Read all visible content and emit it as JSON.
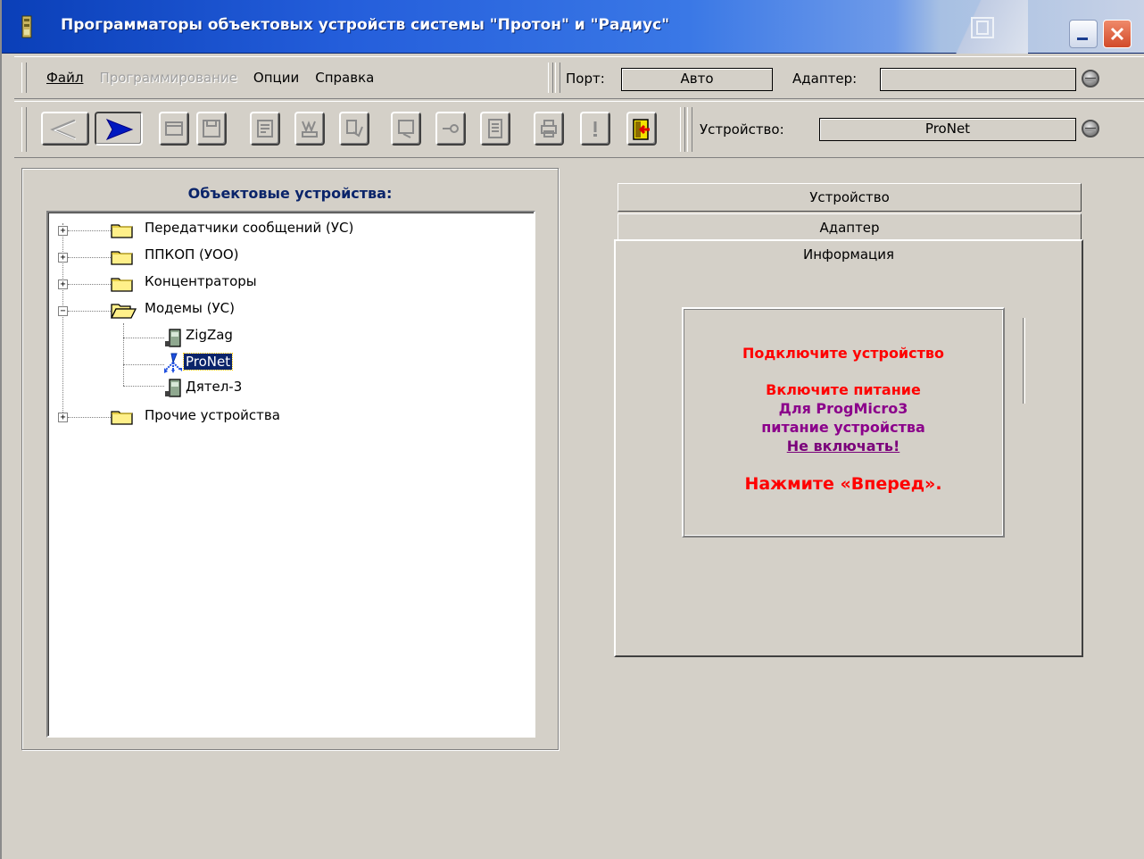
{
  "window": {
    "title": "Программаторы объектовых устройств системы \"Протон\" и \"Радиус\""
  },
  "menu": {
    "items": [
      {
        "label": "Файл",
        "enabled": true
      },
      {
        "label": "Программирование",
        "enabled": false
      },
      {
        "label": "Опции",
        "enabled": true
      },
      {
        "label": "Справка",
        "enabled": true
      }
    ]
  },
  "connection": {
    "port_label": "Порт:",
    "port_value": "Авто",
    "adapter_label": "Адаптер:",
    "adapter_value": ""
  },
  "device_bar": {
    "device_label": "Устройство:",
    "device_value": "ProNet"
  },
  "toolbar": {
    "buttons": [
      "back-icon",
      "forward-icon",
      "open-icon",
      "save-icon",
      "read-icon",
      "write-icon",
      "verify-icon",
      "edit-icon",
      "key-icon",
      "report-icon",
      "print-icon",
      "info-icon",
      "exit-icon"
    ]
  },
  "left_panel": {
    "title": "Объектовые устройства:",
    "tree": [
      {
        "label": "Передатчики сообщений (УС)",
        "expanded": false
      },
      {
        "label": "ППКОП (УОО)",
        "expanded": false
      },
      {
        "label": "Концентраторы",
        "expanded": false
      },
      {
        "label": "Модемы (УС)",
        "expanded": true,
        "children": [
          {
            "label": "ZigZag"
          },
          {
            "label": "ProNet",
            "selected": true
          },
          {
            "label": "Дятел-3"
          }
        ]
      },
      {
        "label": "Прочие устройства",
        "expanded": false
      }
    ]
  },
  "tabs": {
    "items": [
      "Устройство",
      "Адаптер",
      "Информация"
    ],
    "active": "Информация"
  },
  "info": {
    "line1": "Подключите устройство",
    "line2": "Включите питание",
    "line3": "Для ProgMicro3",
    "line4": "питание устройства",
    "line5": "Не включать!",
    "line6": "Нажмите «Вперед»."
  }
}
